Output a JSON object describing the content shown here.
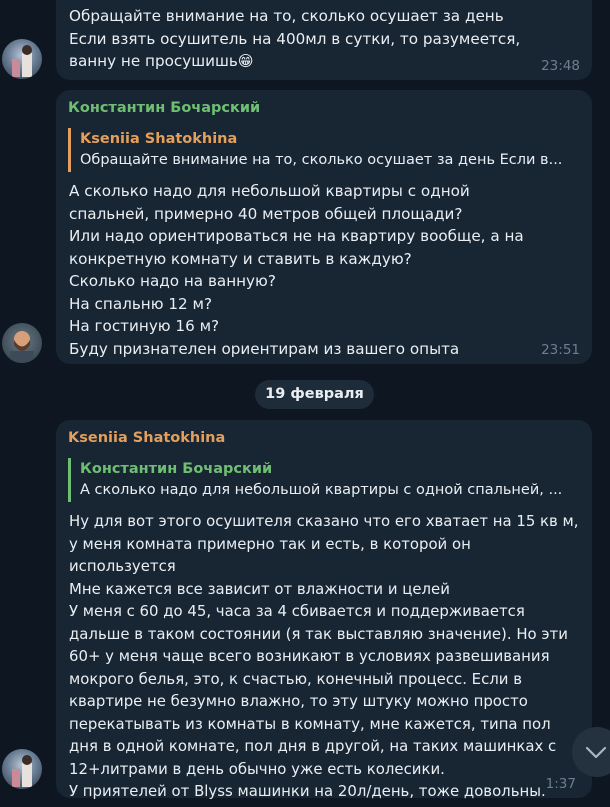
{
  "messages": [
    {
      "text": "Обращайте внимание на то, сколько осушает за день\nЕсли взять осушитель на 400мл в сутки, то разумеется, ванну не просушишь",
      "emoji": "😁",
      "time": "23:48"
    },
    {
      "sender": "Константин Бочарский",
      "reply": {
        "name": "Kseniia Shatokhina",
        "text": "Обращайте внимание на то, сколько осушает за день  Если в..."
      },
      "text": "А сколько надо для небольшой квартиры с одной спальней, примерно 40 метров общей площади?\nИли надо ориентироваться не на квартиру вообще, а на конкретную комнату и ставить в каждую?\nСколько надо на ванную?\nНа спальню 12 м?\nНа гостиную 16 м?\nБуду признателен ориентирам из вашего опыта",
      "time": "23:51"
    },
    {
      "sender": "Kseniia Shatokhina",
      "reply": {
        "name": "Константин Бочарский",
        "text": "А сколько надо для небольшой квартиры с одной спальней, ..."
      },
      "text": "Ну для вот этого осушителя сказано что его хватает на 15 кв м, у меня комната примерно так и есть, в которой он используется\nМне кажется все зависит от влажности и целей\nУ меня с 60 до 45, часа за 4 сбивается и поддерживается дальше в таком состоянии (я так выставляю значение). Но эти 60+ у меня чаще всего возникают в условиях развешивания мокрого белья, это, к счастью, конечный процесс. Если в квартире не безумно влажно, то эту штуку можно просто перекатывать из комнаты в комнату, мне кажется, типа пол дня в одной комнате, пол дня в другой, на таких машинках с 12+литрами в день обычно уже есть колесики.\nУ приятелей от Blyss машинки на 20л/день, тоже довольны.",
      "time": "1:37"
    }
  ],
  "date_separator": "19 февраля",
  "colors": {
    "background": "#0e1621",
    "bubble": "#182533",
    "green_name": "#6fbf73",
    "orange_name": "#e39f5b",
    "time": "#6d7f8f"
  },
  "icons": {
    "scroll_down": "chevron-down-icon"
  }
}
